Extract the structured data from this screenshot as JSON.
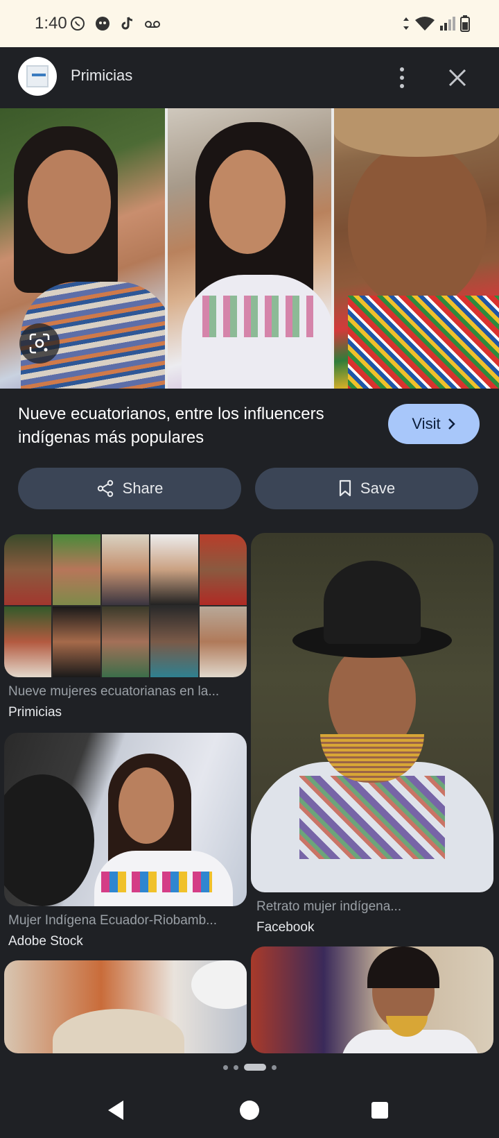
{
  "status_bar": {
    "time": "1:40",
    "left_icons": [
      "whatsapp-icon",
      "app-icon",
      "tiktok-icon",
      "voicemail-icon"
    ],
    "right_icons": [
      "data-arrows-icon",
      "wifi-icon",
      "signal-icon",
      "battery-icon"
    ]
  },
  "header": {
    "site_name": "Primicias",
    "logo_icon": "primicias-logo"
  },
  "preview": {
    "lens_icon": "google-lens-icon"
  },
  "result": {
    "title": "Nueve ecuatorianos, entre los influencers indígenas más populares",
    "visit_label": "Visit"
  },
  "actions": {
    "share_label": "Share",
    "save_label": "Save"
  },
  "related": [
    {
      "caption": "Nueve mujeres ecuatorianas en la...",
      "source": "Primicias"
    },
    {
      "caption": "Retrato mujer indígena...",
      "source": "Facebook"
    },
    {
      "caption": "Mujer Indígena Ecuador-Riobamb...",
      "source": "Adobe Stock"
    }
  ],
  "colors": {
    "background": "#1f2125",
    "status_bar": "#fdf7e9",
    "visit_button": "#a8c7fa",
    "action_button": "#3b4556"
  },
  "pagination": {
    "count": 4,
    "active_index": 2
  }
}
